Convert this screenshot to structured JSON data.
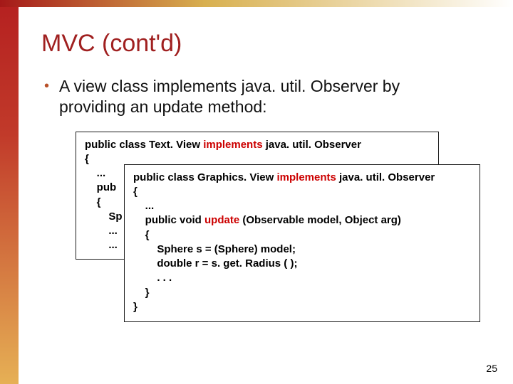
{
  "title": "MVC (cont'd)",
  "bullet": "A view class implements java. util. Observer by providing an update method:",
  "code_back": {
    "l1a": "public class Text. View ",
    "l1b": "implements",
    "l1c": " java. util. Observer",
    "l2": "{",
    "l3": "    ...",
    "l4": "    pub",
    "l5": "    {",
    "l6": "        Sp",
    "l7": "        ...",
    "l8": "        ..."
  },
  "code_front": {
    "l1a": "public class Graphics. View ",
    "l1b": "implements",
    "l1c": " java. util. Observer",
    "l2": "{",
    "l3": "    ...",
    "l4a": "    public void ",
    "l4b": "update",
    "l4c": " (Observable model, Object arg)",
    "l5": "    {",
    "l6": "        Sphere s = (Sphere) model;",
    "l7": "        double r = s. get. Radius ( );",
    "l8": "        . . .",
    "l9": "    }",
    "l10": "}"
  },
  "page_number": "25"
}
